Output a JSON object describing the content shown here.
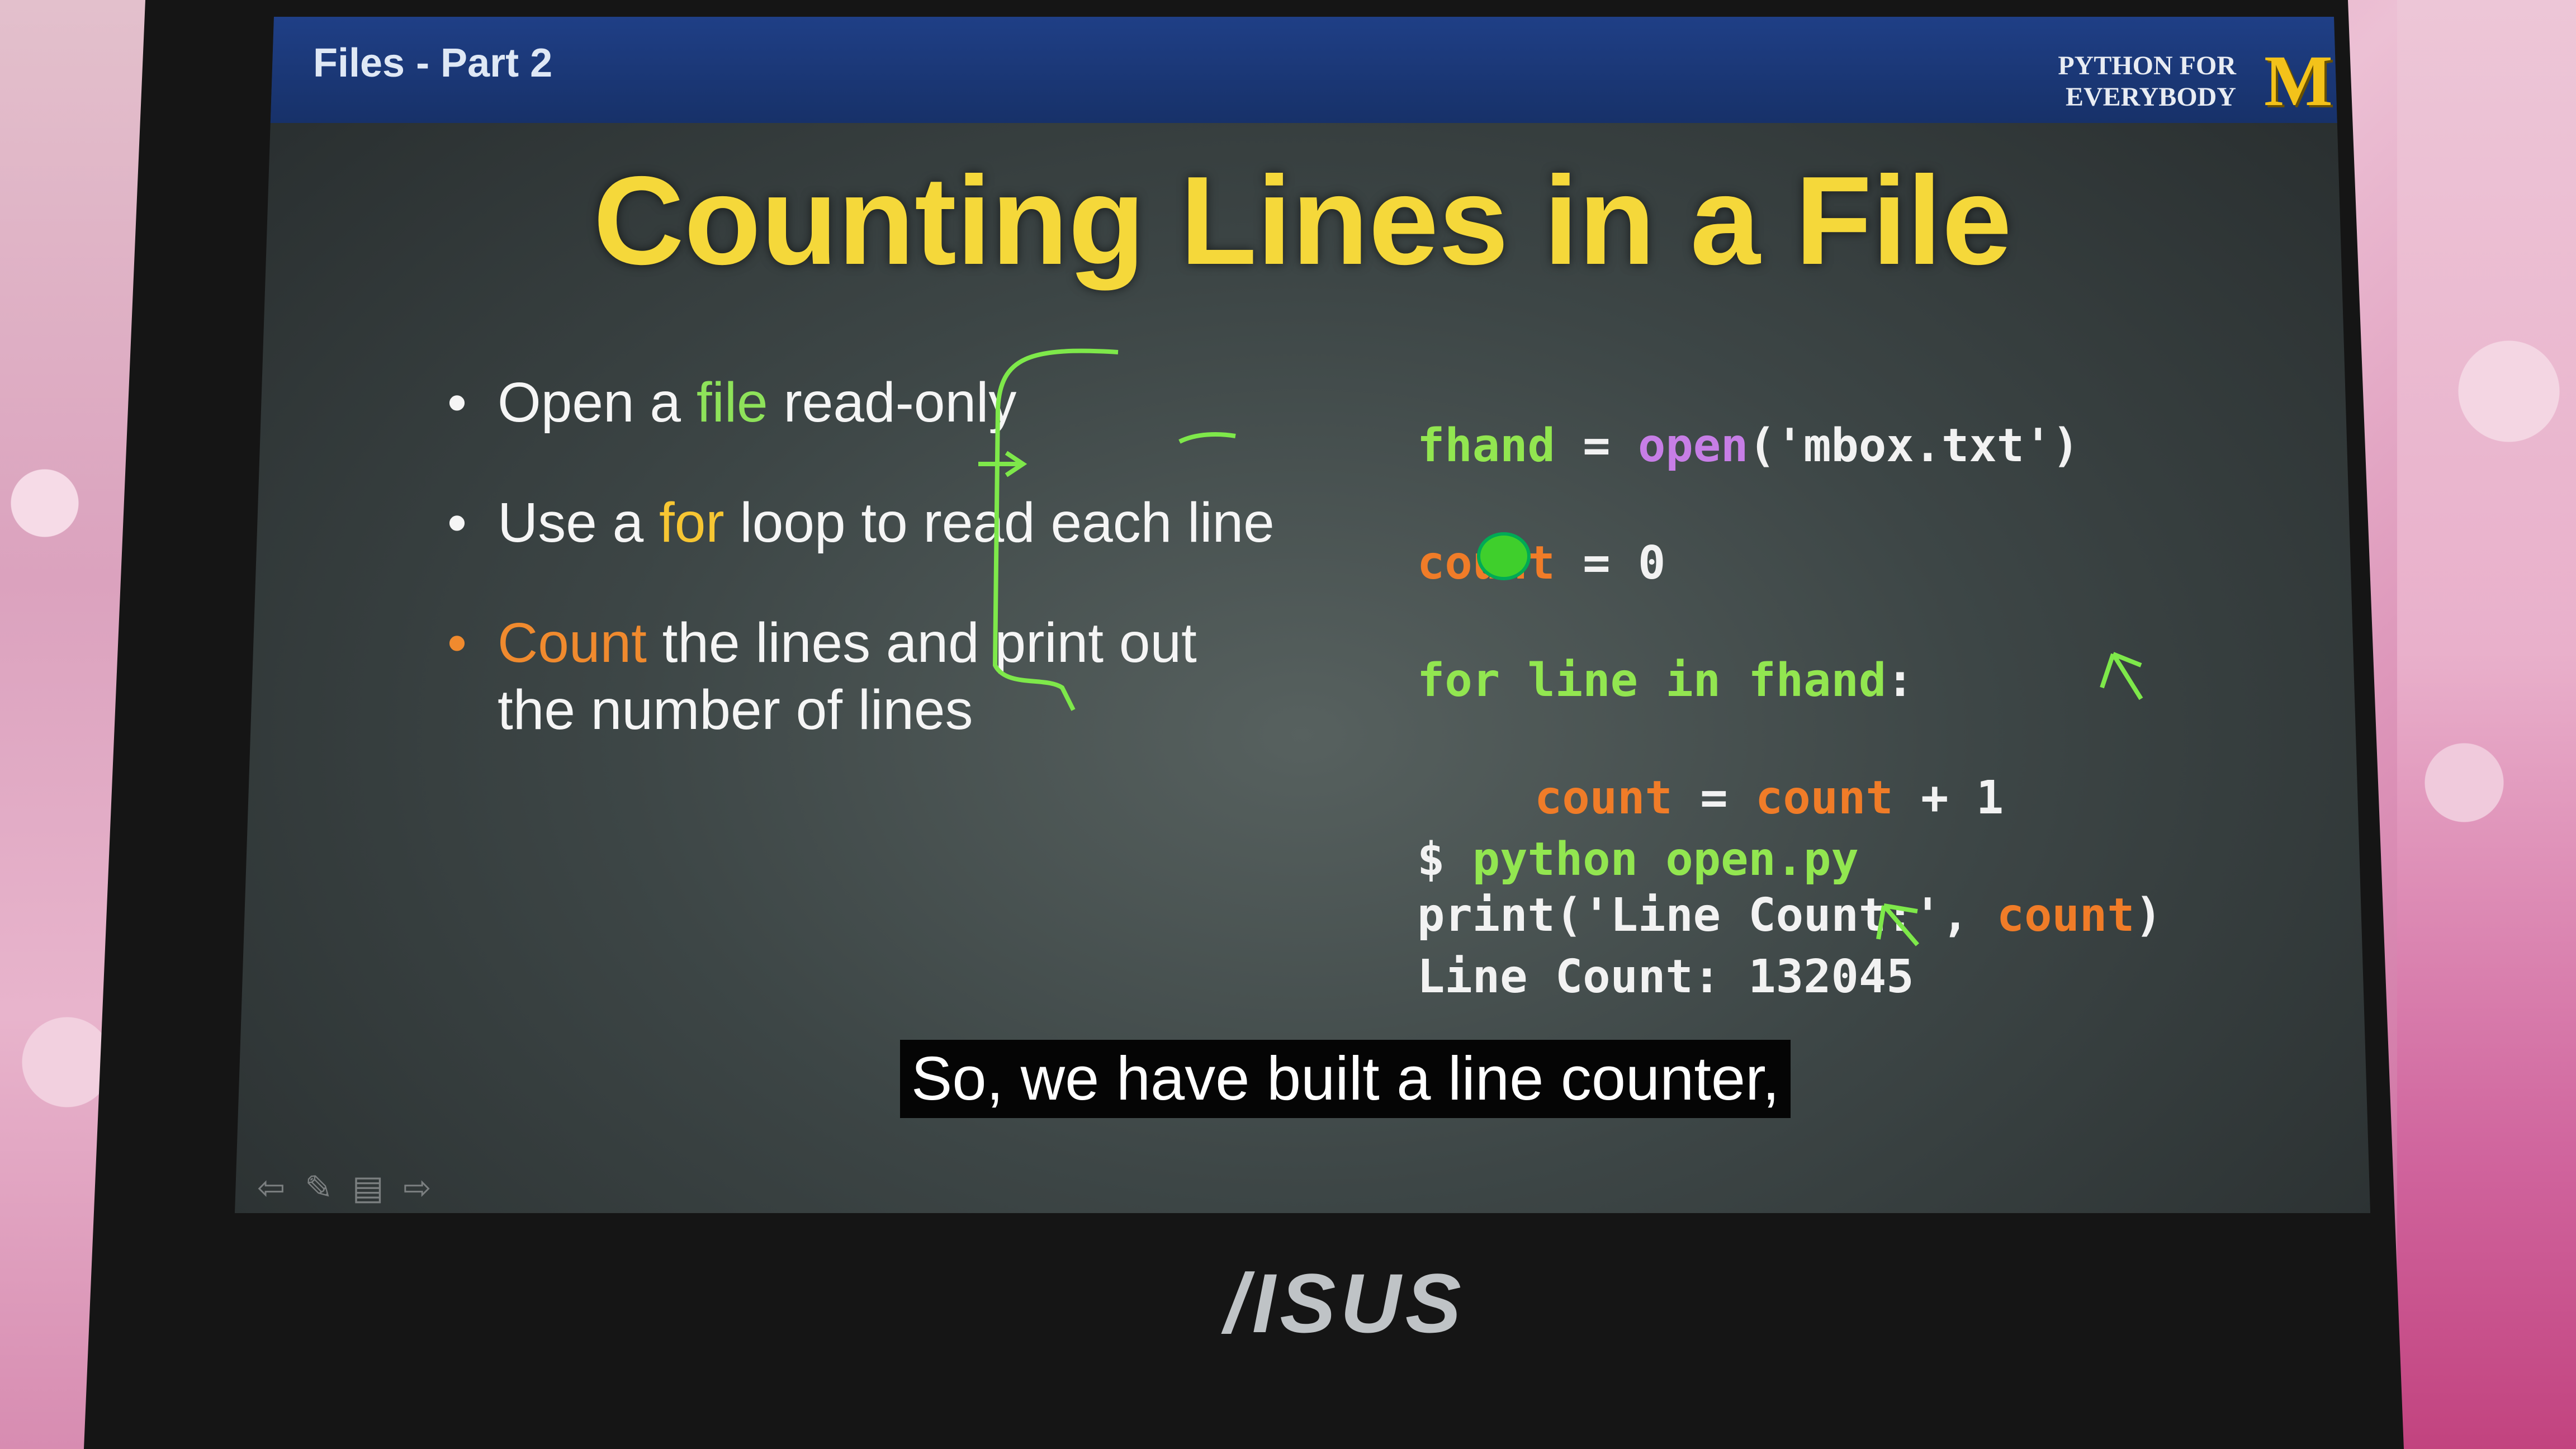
{
  "slide": {
    "lecture_label": "Files - Part 2",
    "brand_line1": "PYTHON FOR",
    "brand_line2": "EVERYBODY",
    "brand_logo": "M",
    "title": "Counting Lines in a File",
    "bullets": [
      {
        "pre": "Open a ",
        "hl": "file",
        "post": " read-only"
      },
      {
        "pre": "Use a ",
        "hl": "for",
        "post": " loop to read each line"
      },
      {
        "hl": "Count",
        "post": " the lines and print out",
        "line2": "the number of lines"
      }
    ],
    "code": {
      "l1_var": "fhand",
      "l1_eq": " = ",
      "l1_fn": "open",
      "l1_arg": "('mbox.txt')",
      "l2_var": "count",
      "l2_rest": " = 0",
      "l3_kw1": "for line in fhand",
      "l3_colon": ":",
      "l4_var1": "count",
      "l4_eq": " = ",
      "l4_var2": "count",
      "l4_rest": " + 1",
      "l5_fn": "print('Line Count:', ",
      "l5_var": "count",
      "l5_close": ")"
    },
    "terminal": {
      "prompt": "$ ",
      "command": "python open.py",
      "output": "Line Count: 132045"
    },
    "caption": "So, we have built a line counter,",
    "controls": [
      "left-arrow-icon",
      "pen-icon",
      "slide-menu-icon",
      "right-arrow-icon"
    ]
  },
  "device": {
    "brand": "/ISUS"
  },
  "colors": {
    "title": "#f5d83a",
    "green": "#92e650",
    "purple": "#c77ee6",
    "orange": "#f07c28",
    "title_bar": "#1f3f86"
  }
}
